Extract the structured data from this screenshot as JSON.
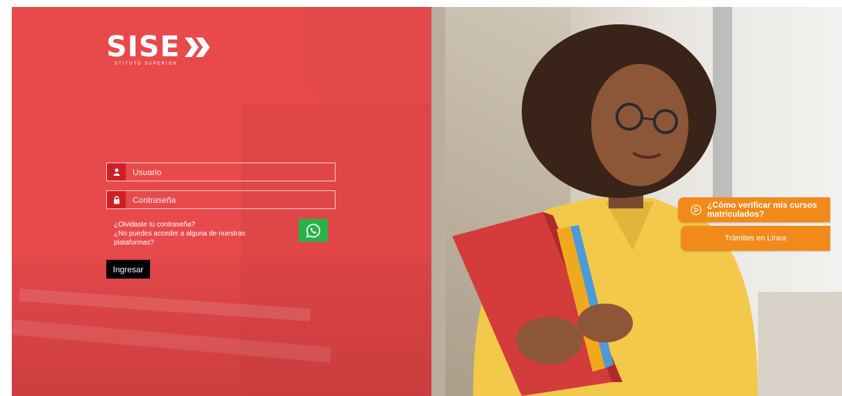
{
  "brand": {
    "name": "SISE",
    "tagline": "STITUTO SUPERIOR"
  },
  "login": {
    "username_placeholder": "Usuario",
    "password_placeholder": "Contraseña",
    "forgot_password": "¿Olvidaste tu contraseña?",
    "cant_access": "¿No puedes acceder a alguna de nuestras plataformas?",
    "submit_label": "Ingresar"
  },
  "side_links": {
    "promo_label": "¿Cómo verificar mis cursos matriculados?",
    "tramites_label": "Trámites en Línea"
  },
  "colors": {
    "brand_red": "#e84a4c",
    "icon_red": "#cf1f24",
    "orange": "#f28a1b",
    "whatsapp_green": "#28b34a"
  },
  "icons": {
    "user": "user-icon",
    "lock": "lock-icon",
    "whatsapp": "whatsapp-icon",
    "play": "play-circle-icon"
  }
}
